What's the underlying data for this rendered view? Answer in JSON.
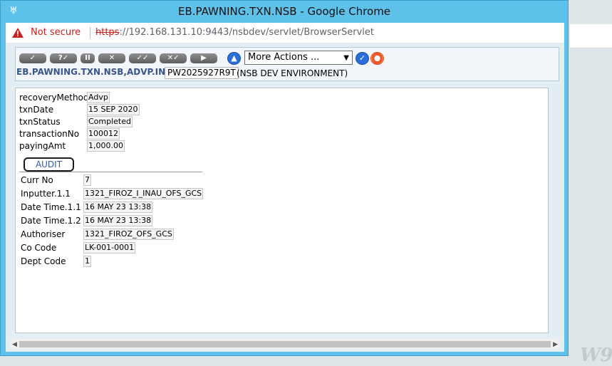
{
  "window": {
    "title": "EB.PAWNING.TXN.NSB - Google Chrome"
  },
  "addressbar": {
    "security_label": "Not secure",
    "url_scheme": "https",
    "url_rest": "://192.168.131.10:9443/nsbdev/servlet/BrowserServlet"
  },
  "toolbar": {
    "buttons": [
      "✓",
      "?✓",
      "II",
      "✕",
      "✓✓",
      "✕✓",
      "▶"
    ],
    "more_actions": "More Actions ...",
    "app_id": "EB.PAWNING.TXN.NSB,ADVP.INPUT",
    "txn_id": "PW2025927R9T",
    "environment": "(NSB DEV ENVIRONMENT)"
  },
  "form": {
    "fields": [
      {
        "label": "recoveryMethod",
        "value": "Advp"
      },
      {
        "label": "txnDate",
        "value": "15 SEP 2020"
      },
      {
        "label": "txnStatus",
        "value": "Completed"
      },
      {
        "label": "transactionNo",
        "value": "100012"
      },
      {
        "label": "payingAmt",
        "value": "1,000.00"
      }
    ],
    "audit_tab": "AUDIT",
    "audit_fields": [
      {
        "label": "Curr No",
        "value": "7"
      },
      {
        "label": "Inputter.1.1",
        "value": "1321_FIROZ_I_INAU_OFS_GCS"
      },
      {
        "label": "Date Time.1.1",
        "value": "16 MAY 23 13:38"
      },
      {
        "label": "Date Time.1.2",
        "value": "16 MAY 23 13:38"
      },
      {
        "label": "Authoriser",
        "value": "1321_FIROZ_OFS_GCS"
      },
      {
        "label": "Co Code",
        "value": "LK-001-0001"
      },
      {
        "label": "Dept Code",
        "value": "1"
      }
    ]
  },
  "watermark": "W9",
  "colors": {
    "window_frame": "#5dc1ea",
    "taskbar": "#1a4e8c",
    "not_secure": "#c5221f",
    "app_id": "#3a5688"
  }
}
